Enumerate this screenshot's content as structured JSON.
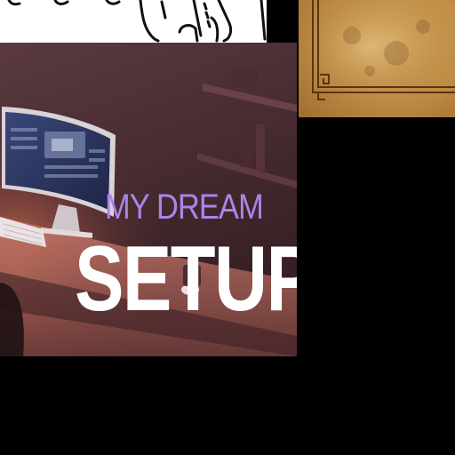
{
  "poster": {
    "headline_line1": "MY DREAM",
    "headline_line2": "SETUP",
    "colors": {
      "accent_purple": "#a985ea",
      "headline_white": "#ffffff",
      "background_mauve": "#4a2e33",
      "lamp_glow": "#f08a52"
    }
  },
  "tiles": {
    "sketch_icon": "line-art-sketch",
    "parchment_icon": "ornate-parchment-border"
  }
}
